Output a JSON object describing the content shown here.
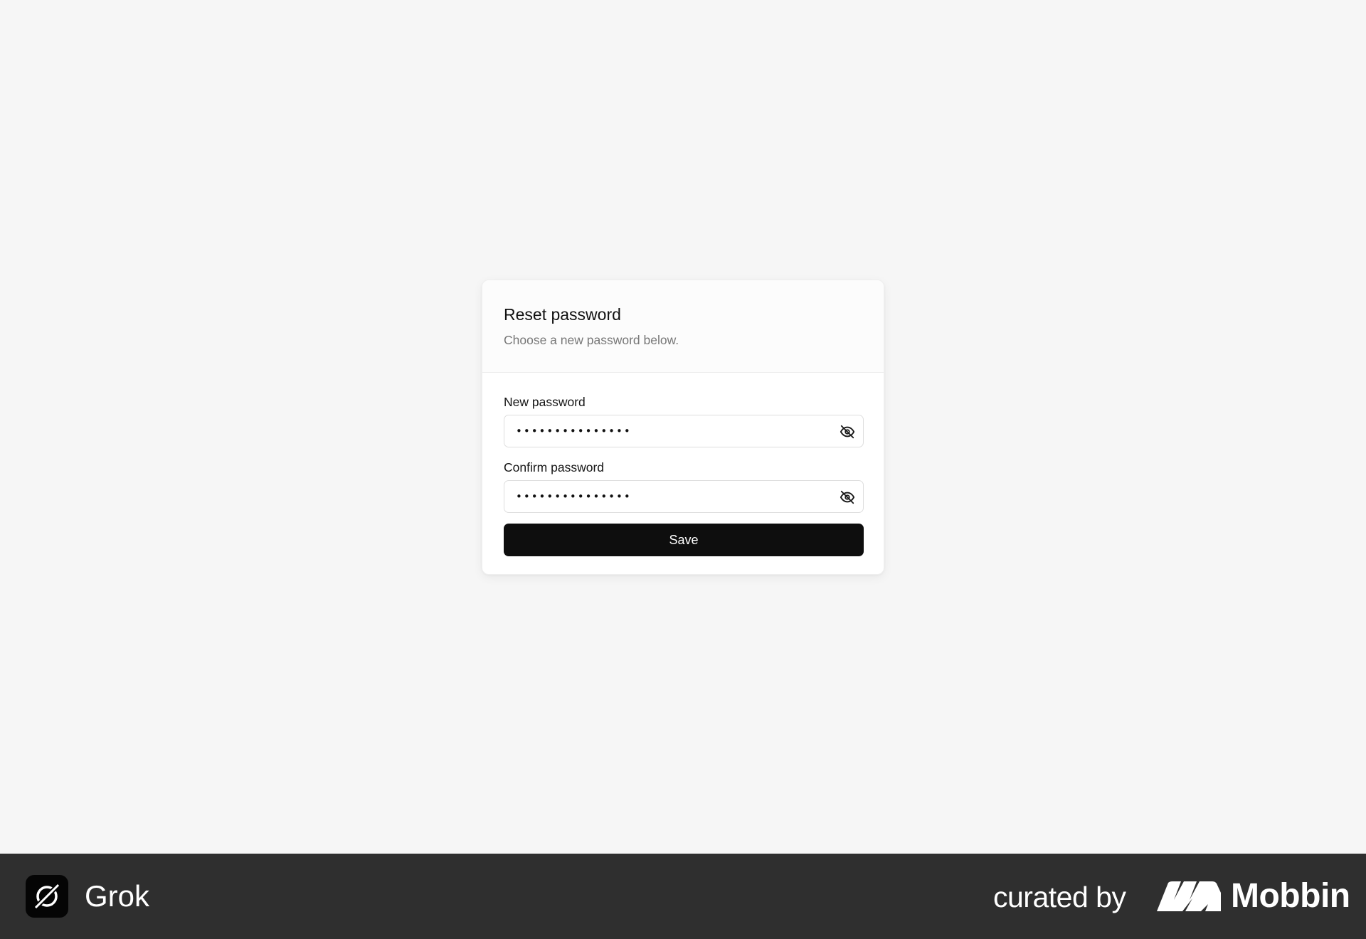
{
  "reset_card": {
    "title": "Reset password",
    "subtitle": "Choose a new password below.",
    "new_password": {
      "label": "New password",
      "value": "passwordpasswor",
      "toggle_icon": "eye-off-icon"
    },
    "confirm_password": {
      "label": "Confirm password",
      "value": "passwordpasswor",
      "toggle_icon": "eye-off-icon"
    },
    "save_label": "Save"
  },
  "footer": {
    "app_name": "Grok",
    "app_icon": "grok-logo-icon",
    "curated_text": "curated by",
    "brand_name": "Mobbin",
    "brand_icon": "mobbin-logo-icon"
  },
  "colors": {
    "background": "#f6f6f6",
    "card": "#ffffff",
    "primary_button": "#0e0e0e",
    "footer": "#2f2f2f"
  }
}
